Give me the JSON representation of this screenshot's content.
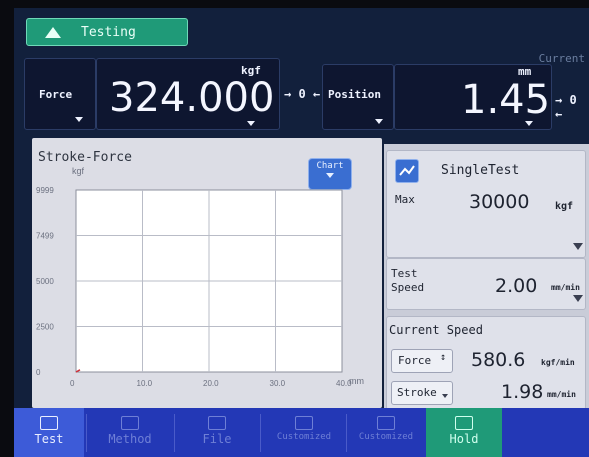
{
  "status": {
    "label": "Testing"
  },
  "corner_label": "Current",
  "readouts": {
    "force": {
      "label": "Force",
      "value": "324.000",
      "unit": "kgf",
      "zero_label": "→ 0 ←"
    },
    "position": {
      "label": "Position",
      "value": "1.45",
      "unit": "mm",
      "zero_label": "→ 0 ←"
    }
  },
  "chart": {
    "title": "Stroke-Force",
    "button_label": "Chart",
    "y_unit": "kgf",
    "x_unit": "mm"
  },
  "chart_data": {
    "type": "line",
    "title": "Stroke-Force",
    "xlabel": "mm",
    "ylabel": "kgf",
    "xlim": [
      0,
      40
    ],
    "ylim": [
      0,
      9999
    ],
    "x_ticks": [
      "0",
      "10.0",
      "20.0",
      "30.0",
      "40.0"
    ],
    "y_ticks": [
      "0",
      "2500",
      "5000",
      "7499",
      "9999"
    ],
    "series": [
      {
        "x": [
          0,
          0.6
        ],
        "y": [
          0,
          120
        ]
      }
    ]
  },
  "test_info": {
    "mode": "SingleTest",
    "max_label": "Max",
    "max_value": "30000",
    "max_unit": "kgf",
    "speed_label_1": "Test",
    "speed_label_2": "Speed",
    "speed_value": "2.00",
    "speed_unit": "mm/min"
  },
  "current_speed": {
    "title": "Current Speed",
    "force_label": "Force",
    "force_value": "580.6",
    "force_unit": "kgf/min",
    "stroke_label": "Stroke",
    "stroke_value": "1.98",
    "stroke_unit": "mm/min"
  },
  "nav": [
    {
      "label": "Test"
    },
    {
      "label": "Method"
    },
    {
      "label": "File"
    },
    {
      "label": "Customized"
    },
    {
      "label": "Customized"
    },
    {
      "label": "Hold"
    }
  ],
  "colors": {
    "accent": "#1f9a78",
    "nav": "#2338b6",
    "chart_button": "#3a6ed1"
  }
}
